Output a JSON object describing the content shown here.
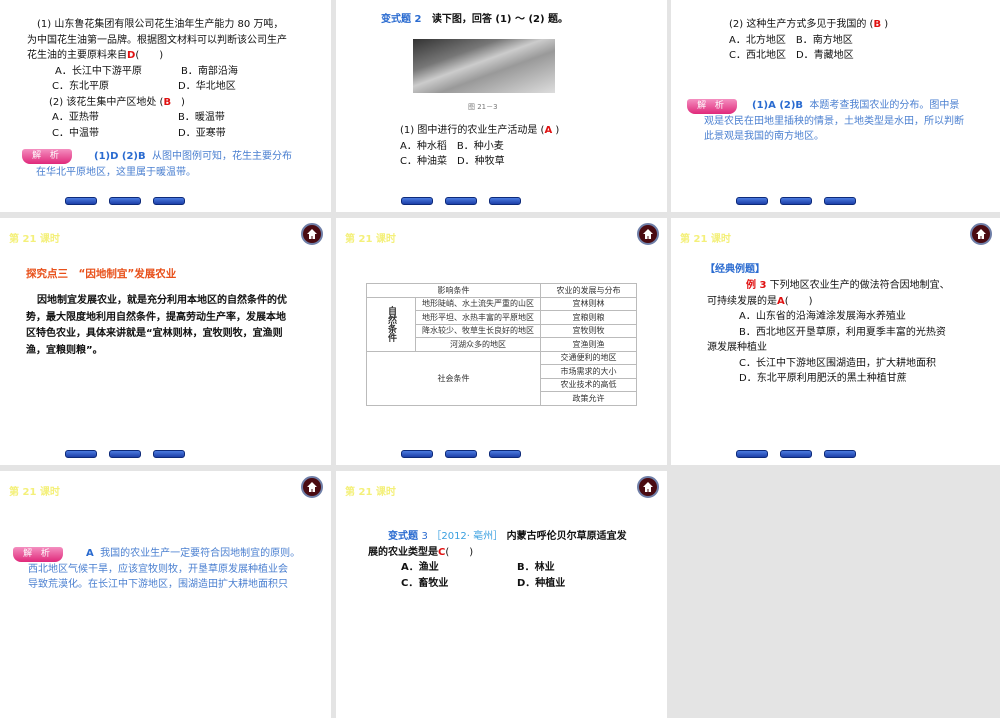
{
  "lesson": "第 21 课时",
  "analysis_tag": "解 析",
  "s1": {
    "lines": [
      "(1) 山东鲁花集团有限公司花生油年生产能力 80 万吨，",
      "为中国花生油第一品牌。根据图文材料可以判断该公司生产",
      "花生油的主要原料来自"
    ],
    "ans1": "D",
    "paren": "(　　)",
    "opts1": [
      "A．长江中下游平原",
      "B．南部沿海",
      "C．东北平原",
      "D．华北地区"
    ],
    "q2": "(2) 该花生集中产区地处 (",
    "ans2": "B",
    "q2end": "　)",
    "opts2": [
      "A．亚热带",
      "B．暖温带",
      "C．中温带",
      "D．亚寒带"
    ],
    "ana_key": "(1)D (2)B",
    "ana": [
      "从图中图例可知，花生主要分布",
      "在华北平原地区，这里属于暖温带。"
    ]
  },
  "s2": {
    "label": "变式题 2",
    "title": "读下图，回答 (1) ～ (2) 题。",
    "caption": "图 21－3",
    "q": "(1) 图中进行的农业生产活动是 (",
    "ans": "A",
    "qend": " )",
    "opts": [
      "A．种水稻　B．种小麦",
      "C．种油菜　D．种牧草"
    ]
  },
  "s3": {
    "q": "(2) 这种生产方式多见于我国的 (",
    "ans": "B",
    "qend": " )",
    "opts": [
      "A．北方地区　B．南方地区",
      "C．西北地区　D．青藏地区"
    ],
    "ana_key": "(1)A (2)B",
    "ana": [
      "本题考查我国农业的分布。图中景",
      "观是农民在田地里插秧的情景，土地类型是水田，所以判断",
      "此景观是我国的南方地区。"
    ]
  },
  "s4": {
    "heading": "探究点三　“因地制宜”发展农业",
    "para": [
      "因地制宜发展农业，就是充分利用本地区的自然条件的优",
      "势，最大限度地利用自然条件，提高劳动生产率，发展本地",
      "区特色农业，具体来讲就是“宜林则林，宜牧则牧，宜渔则",
      "渔，宜粮则粮”。"
    ]
  },
  "s5": {
    "h1": "影响条件",
    "h2": "农业的发展与分布",
    "nat": "自然条件",
    "natural": [
      [
        "地形陡峭、水土流失严重的山区",
        "宜林则林"
      ],
      [
        "地形平坦、水热丰富的平原地区",
        "宜粮则粮"
      ],
      [
        "降水较少、牧草生长良好的地区",
        "宜牧则牧"
      ],
      [
        "河湖众多的地区",
        "宜渔则渔"
      ]
    ],
    "soc": "社会条件",
    "social": [
      "交通便利的地区",
      "市场需求的大小",
      "农业技术的高低",
      "政策允许"
    ]
  },
  "s6": {
    "heading": "【经典例题】",
    "label": "例 3",
    "q1": "下列地区农业生产的做法符合因地制宜、",
    "q2": "可持续发展的是",
    "ans": "A",
    "paren": "(　　)",
    "opts": [
      "A．山东省的沿海滩涂发展海水养殖业",
      "B．西北地区开垦草原，利用夏季丰富的光热资",
      "源发展种植业",
      "C．长江中下游地区围湖造田，扩大耕地面积",
      "D．东北平原利用肥沃的黑土种植甘蔗"
    ]
  },
  "s7": {
    "ana_key": "A",
    "ana": [
      "我国的农业生产一定要符合因地制宜的原则。",
      "西北地区气候干旱，应该宜牧则牧，开垦草原发展种植业会",
      "导致荒漠化。在长江中下游地区，围湖造田扩大耕地面积只"
    ]
  },
  "s8": {
    "label": "变式题",
    "num": "3",
    "src": "［2012· 亳州］",
    "q1": "内蒙古呼伦贝尔草原适宜发",
    "q2": "展的农业类型是",
    "ans": "C",
    "paren": "(　　)",
    "opts": [
      "A．渔业",
      "B．林业",
      "C．畜牧业",
      "D．种植业"
    ]
  }
}
